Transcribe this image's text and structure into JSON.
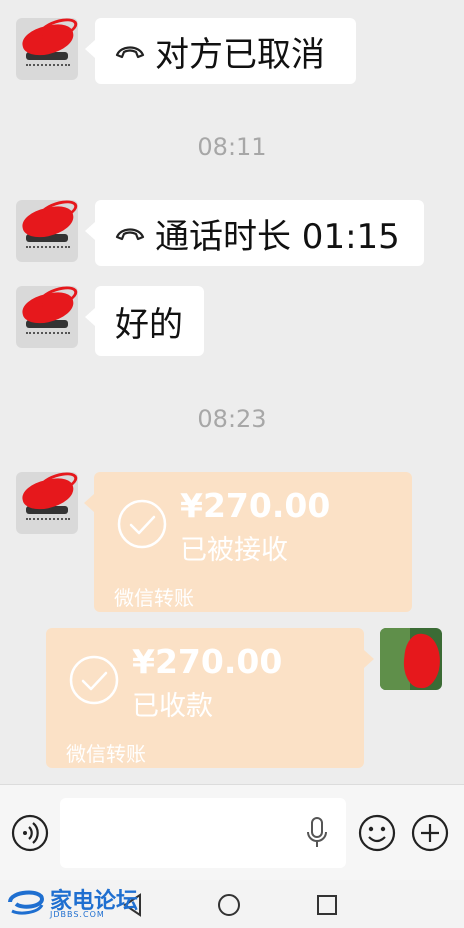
{
  "messages": [
    {
      "type": "call",
      "text": "对方已取消"
    },
    {
      "type": "time",
      "text": "08:11"
    },
    {
      "type": "call",
      "text": "通话时长 01:15"
    },
    {
      "type": "text",
      "text": "好的"
    },
    {
      "type": "time",
      "text": "08:23"
    }
  ],
  "transfer_in": {
    "amount": "¥270.00",
    "status": "已被接收",
    "label": "微信转账"
  },
  "transfer_out": {
    "amount": "¥270.00",
    "status": "已收款",
    "label": "微信转账"
  },
  "input": {
    "placeholder": ""
  },
  "icons": {
    "voice": "voice-input-icon",
    "mic": "microphone-icon",
    "emoji": "emoji-icon",
    "plus": "plus-icon",
    "call": "phone-hangup-icon",
    "check": "check-circle-icon"
  },
  "navbar": {
    "back": "back-icon",
    "home": "home-icon",
    "recent": "recents-icon"
  },
  "watermark": {
    "text": "家电论坛",
    "sub": "JDBBS.COM"
  },
  "colors": {
    "background": "#ededed",
    "bubble": "#ffffff",
    "transfer": "#fbe1c6",
    "accent_red": "#e6181c"
  }
}
